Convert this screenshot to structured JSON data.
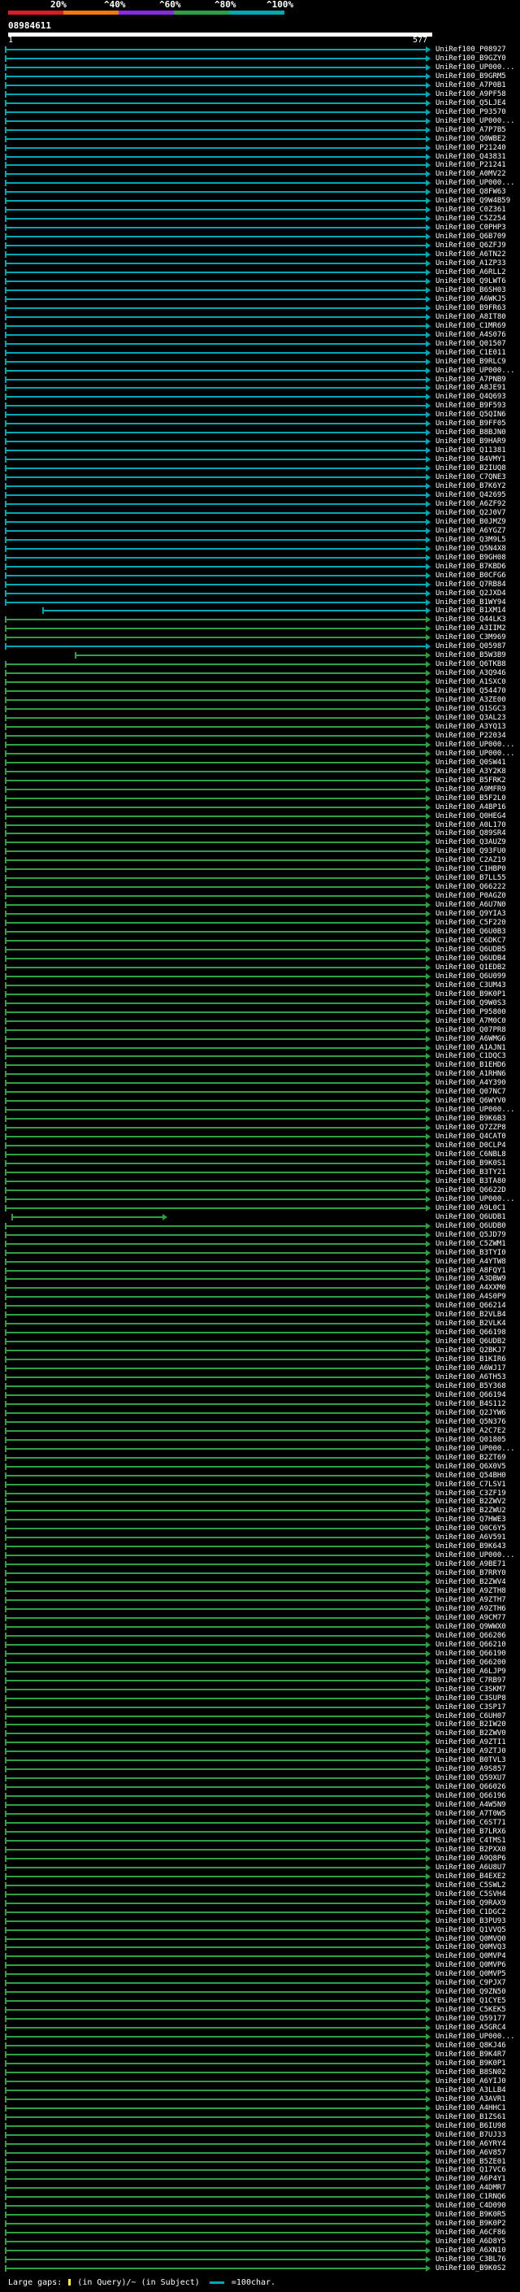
{
  "scale": {
    "labels": [
      "20%",
      "^40%",
      "^60%",
      "^80%",
      "^100%"
    ],
    "colors": [
      "#e01b24",
      "#ef7a0c",
      "#8a2be2",
      "#2ea043",
      "#00a7b5"
    ]
  },
  "query": {
    "title": "08984611",
    "start": "1",
    "end": "577"
  },
  "footer": {
    "gaps_label": "Large gaps:",
    "in_query_label": "(in Query)/~",
    "in_subject_label": "(in Subject)",
    "bar_label": "=100char."
  },
  "hits": {
    "labels": [
      "UniRef100_P08927",
      "UniRef100_B9GZY0",
      "UniRef100_UP000...",
      "UniRef100_B9GRM5",
      "UniRef100_A7P0B1",
      "UniRef100_A9PF58",
      "UniRef100_Q5LJE4",
      "UniRef100_P93570",
      "UniRef100_UP000...",
      "UniRef100_A7P7B5",
      "UniRef100_Q0WBE2",
      "UniRef100_P21240",
      "UniRef100_Q43831",
      "UniRef100_P21241",
      "UniRef100_A0MV22",
      "UniRef100_UP000...",
      "UniRef100_Q8FW63",
      "UniRef100_Q9W4B59",
      "UniRef100_C0Z361",
      "UniRef100_C5Z254",
      "UniRef100_C0PHP3",
      "UniRef100_Q6B709",
      "UniRef100_Q6ZFJ9",
      "UniRef100_A6TN22",
      "UniRef100_A1ZP33",
      "UniRef100_A6RLL2",
      "UniRef100_Q9LWT6",
      "UniRef100_B6SH03",
      "UniRef100_A6WKJ5",
      "UniRef100_B9FR63",
      "UniRef100_A8IT80",
      "UniRef100_C1MR69",
      "UniRef100_A4S076",
      "UniRef100_Q01507",
      "UniRef100_C1E011",
      "UniRef100_B9RLC9",
      "UniRef100_UP000...",
      "UniRef100_A7PNB9",
      "UniRef100_A8JE91",
      "UniRef100_Q4Q693",
      "UniRef100_B9F593",
      "UniRef100_Q5QIN6",
      "UniRef100_B9FF05",
      "UniRef100_B8BJN0",
      "UniRef100_B9HAR9",
      "UniRef100_Q11381",
      "UniRef100_B4VMY1",
      "UniRef100_B2IUQ8",
      "UniRef100_C7QNE3",
      "UniRef100_B7K6Y2",
      "UniRef100_Q42695",
      "UniRef100_A6ZF92",
      "UniRef100_Q2J0V7",
      "UniRef100_B0JMZ9",
      "UniRef100_A6YGZ7",
      "UniRef100_Q3M9L5",
      "UniRef100_Q5N4X8",
      "UniRef100_B9GH08",
      "UniRef100_B7KBD6",
      "UniRef100_B0CFG6",
      "UniRef100_Q7RB84",
      "UniRef100_Q2JXD4",
      "UniRef100_B1WY94",
      "UniRef100_B1XM14",
      "UniRef100_Q44LK3",
      "UniRef100_A3IIM2",
      "UniRef100_C3M969",
      "UniRef100_Q05987",
      "UniRef100_B5W3B9",
      "UniRef100_Q6TKB8",
      "UniRef100_A3Q946",
      "UniRef100_A1SXC0",
      "UniRef100_Q54470",
      "UniRef100_A3ZE00",
      "UniRef100_Q1SGC3",
      "UniRef100_Q3AL23",
      "UniRef100_A3YQ13",
      "UniRef100_P22034",
      "UniRef100_UP000...",
      "UniRef100_UP000...",
      "UniRef100_Q0SW41",
      "UniRef100_A3Y2K8",
      "UniRef100_B5FRK2",
      "UniRef100_A9MFR9",
      "UniRef100_B5F2L0",
      "UniRef100_A4BP16",
      "UniRef100_Q0HEG4",
      "UniRef100_A0L170",
      "UniRef100_Q89SR4",
      "UniRef100_Q3AUZ9",
      "UniRef100_Q93FU0",
      "UniRef100_C2AZ19",
      "UniRef100_C1HBP0",
      "UniRef100_B7LL55",
      "UniRef100_Q66222",
      "UniRef100_P0AGZ0",
      "UniRef100_A6U7N0",
      "UniRef100_Q9YIA3",
      "UniRef100_C5F220",
      "UniRef100_Q6U0B3",
      "UniRef100_C6DKC7",
      "UniRef100_Q6UDB5",
      "UniRef100_Q6UDB4",
      "UniRef100_Q1EDB2",
      "UniRef100_Q6U099",
      "UniRef100_C3UM43",
      "UniRef100_B9K0P1",
      "UniRef100_Q9W0S3",
      "UniRef100_P95800",
      "UniRef100_A7M0C0",
      "UniRef100_Q07PR8",
      "UniRef100_A6WMG6",
      "UniRef100_A1AJN1",
      "UniRef100_C1DQC3",
      "UniRef100_B1EHD6",
      "UniRef100_A1RHN6",
      "UniRef100_A4Y390",
      "UniRef100_Q07NC7",
      "UniRef100_Q6WYV0",
      "UniRef100_UP000...",
      "UniRef100_B9K6B3",
      "UniRef100_Q7ZZP8",
      "UniRef100_Q4CAT0",
      "UniRef100_D0CLP4",
      "UniRef100_C6NBL8",
      "UniRef100_B9K0S1",
      "UniRef100_B3TY21",
      "UniRef100_B3TA80",
      "UniRef100_Q6622D",
      "UniRef100_UP000...",
      "UniRef100_A9L0C1",
      "UniRef100_Q6UDB1",
      "UniRef100_Q6UDB0",
      "UniRef100_Q5JD79",
      "UniRef100_C5ZWM1",
      "UniRef100_B3TYI0",
      "UniRef100_A4YTW8",
      "UniRef100_A8FQY1",
      "UniRef100_A3DBW9",
      "UniRef100_A4XXM0",
      "UniRef100_A4S0P9",
      "UniRef100_Q66214",
      "UniRef100_B2VLB4",
      "UniRef100_B2VLK4",
      "UniRef100_Q66198",
      "UniRef100_Q6UDB2",
      "UniRef100_Q2BKJ7",
      "UniRef100_B1KIR6",
      "UniRef100_A6WJ17",
      "UniRef100_A6TH53",
      "UniRef100_B5Y368",
      "UniRef100_Q66194",
      "UniRef100_B4S112",
      "UniRef100_Q2JYW6",
      "UniRef100_Q5N376",
      "UniRef100_A2C7E2",
      "UniRef100_Q01805",
      "UniRef100_UP000...",
      "UniRef100_B2ZT69",
      "UniRef100_Q6X0V5",
      "UniRef100_Q54BH0",
      "UniRef100_C7LSV1",
      "UniRef100_C3ZF19",
      "UniRef100_B2ZWV2",
      "UniRef100_B2ZWU2",
      "UniRef100_Q7HWE3",
      "UniRef100_Q0C6Y5",
      "UniRef100_A6V591",
      "UniRef100_B9K643",
      "UniRef100_UP000...",
      "UniRef100_A9BE71",
      "UniRef100_B7RRY0",
      "UniRef100_B2ZWV4",
      "UniRef100_A9ZTH8",
      "UniRef100_A9ZTH7",
      "UniRef100_A9ZTH6",
      "UniRef100_A9CM77",
      "UniRef100_Q9WWX0",
      "UniRef100_Q66206",
      "UniRef100_Q66210",
      "UniRef100_Q66190",
      "UniRef100_Q66200",
      "UniRef100_A6LJP9",
      "UniRef100_C7RB97",
      "UniRef100_C3SKM7",
      "UniRef100_C3SUP8",
      "UniRef100_C3SP17",
      "UniRef100_C6UH07",
      "UniRef100_B2IW20",
      "UniRef100_B2ZWV0",
      "UniRef100_A9ZTI1",
      "UniRef100_A9ZTJ0",
      "UniRef100_B0TVL3",
      "UniRef100_A9S857",
      "UniRef100_Q59XU7",
      "UniRef100_Q66026",
      "UniRef100_Q66196",
      "UniRef100_A4W5N9",
      "UniRef100_A7T0W5",
      "UniRef100_C6ST71",
      "UniRef100_B7LRX6",
      "UniRef100_C4TMS1",
      "UniRef100_B2PXX0",
      "UniRef100_A9Q8P6",
      "UniRef100_A6U8U7",
      "UniRef100_B4EXE2",
      "UniRef100_C5SWL2",
      "UniRef100_C5SVH4",
      "UniRef100_Q9RAX9",
      "UniRef100_C1DGC2",
      "UniRef100_B3PU93",
      "UniRef100_Q1VVQ5",
      "UniRef100_Q0MVQ0",
      "UniRef100_Q0MVQ3",
      "UniRef100_Q0MVP4",
      "UniRef100_Q0MVP6",
      "UniRef100_Q0MVP5",
      "UniRef100_C9PJX7",
      "UniRef100_Q9ZN50",
      "UniRef100_Q1CYE5",
      "UniRef100_C5KEK5",
      "UniRef100_Q59177",
      "UniRef100_A5GRC4",
      "UniRef100_UP000...",
      "UniRef100_Q8KJ46",
      "UniRef100_B9K4R7",
      "UniRef100_B9K0P1",
      "UniRef100_B8SN02",
      "UniRef100_A6YIJ0",
      "UniRef100_A3LLB4",
      "UniRef100_A3AVR1",
      "UniRef100_A4HHC1",
      "UniRef100_B1ZS61",
      "UniRef100_B6IU98",
      "UniRef100_B7UJ33",
      "UniRef100_A6YRY4",
      "UniRef100_A6V857",
      "UniRef100_B5ZE01",
      "UniRef100_Q17VC6",
      "UniRef100_A6P4Y1",
      "UniRef100_A4DMR7",
      "UniRef100_C1RNQ6",
      "UniRef100_C4D090",
      "UniRef100_B9K0R5",
      "UniRef100_B9K0P2",
      "UniRef100_A6CF86",
      "UniRef100_A6D8Y5",
      "UniRef100_A6XN10",
      "UniRef100_C3BL76",
      "UniRef100_B9K0S2"
    ]
  }
}
